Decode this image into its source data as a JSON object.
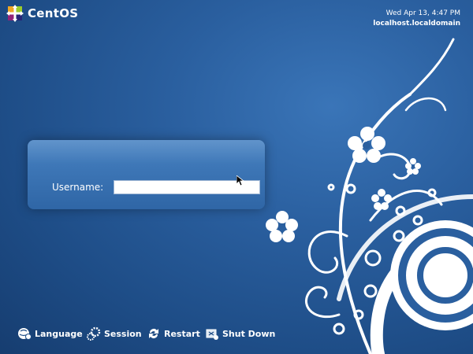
{
  "brand": {
    "name": "CentOS"
  },
  "clock": {
    "datetime": "Wed Apr 13,  4:47 PM",
    "hostname": "localhost.localdomain"
  },
  "login": {
    "username_label": "Username:",
    "username_value": ""
  },
  "actions": [
    {
      "label": "Language",
      "icon": "language-icon"
    },
    {
      "label": "Session",
      "icon": "session-icon"
    },
    {
      "label": "Restart",
      "icon": "restart-icon"
    },
    {
      "label": "Shut Down",
      "icon": "shutdown-icon"
    }
  ],
  "colors": {
    "background": "#2a5f9f",
    "panel": "#3d76b6",
    "text": "#ffffff"
  }
}
